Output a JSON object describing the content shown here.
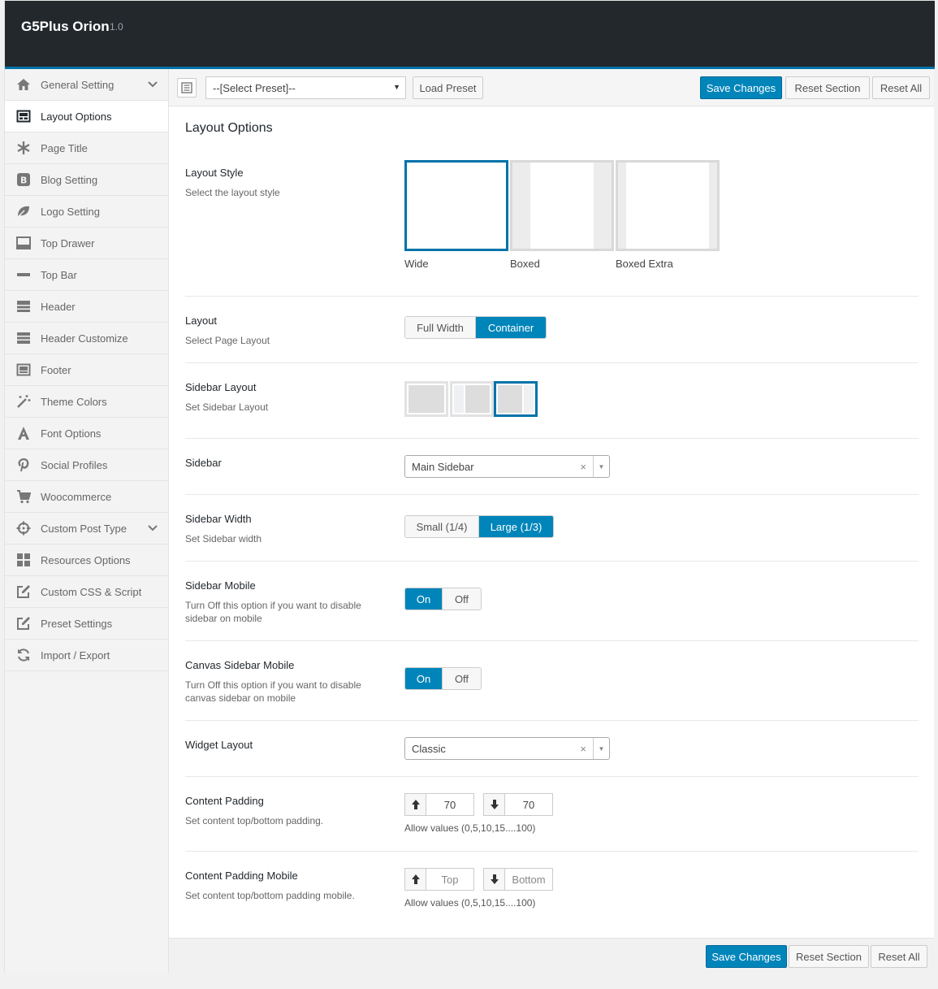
{
  "app": {
    "title": "G5Plus Orion",
    "version": "1.0"
  },
  "sidebar": {
    "items": [
      {
        "label": "General Setting",
        "icon": "home-icon"
      },
      {
        "label": "Layout Options",
        "icon": "layout-icon"
      },
      {
        "label": "Page Title",
        "icon": "asterisk-icon"
      },
      {
        "label": "Blog Setting",
        "icon": "blog-icon"
      },
      {
        "label": "Logo Setting",
        "icon": "leaf-icon"
      },
      {
        "label": "Top Drawer",
        "icon": "drawer-icon"
      },
      {
        "label": "Top Bar",
        "icon": "minus-icon"
      },
      {
        "label": "Header",
        "icon": "header-icon"
      },
      {
        "label": "Header Customize",
        "icon": "header-customize-icon"
      },
      {
        "label": "Footer",
        "icon": "footer-icon"
      },
      {
        "label": "Theme Colors",
        "icon": "magic-wand-icon"
      },
      {
        "label": "Font Options",
        "icon": "font-icon"
      },
      {
        "label": "Social Profiles",
        "icon": "pinterest-icon"
      },
      {
        "label": "Woocommerce",
        "icon": "cart-icon"
      },
      {
        "label": "Custom Post Type",
        "icon": "crosshairs-icon"
      },
      {
        "label": "Resources Options",
        "icon": "grid-icon"
      },
      {
        "label": "Custom CSS & Script",
        "icon": "edit-icon"
      },
      {
        "label": "Preset Settings",
        "icon": "edit-icon"
      },
      {
        "label": "Import / Export",
        "icon": "refresh-icon"
      }
    ]
  },
  "toolbar": {
    "preset_placeholder": "--[Select Preset]--",
    "load_preset": "Load Preset",
    "save_changes": "Save Changes",
    "reset_section": "Reset Section",
    "reset_all": "Reset All"
  },
  "section": {
    "title": "Layout Options",
    "layout_style": {
      "label": "Layout Style",
      "desc": "Select the layout style",
      "options": [
        "Wide",
        "Boxed",
        "Boxed Extra"
      ],
      "selected": "Wide"
    },
    "layout": {
      "label": "Layout",
      "desc": "Select Page Layout",
      "options": [
        "Full Width",
        "Container"
      ],
      "selected": "Container"
    },
    "sidebar_layout": {
      "label": "Sidebar Layout",
      "desc": "Set Sidebar Layout",
      "selected_index": 2
    },
    "sidebar": {
      "label": "Sidebar",
      "value": "Main Sidebar"
    },
    "sidebar_width": {
      "label": "Sidebar Width",
      "desc": "Set Sidebar width",
      "options": [
        "Small (1/4)",
        "Large (1/3)"
      ],
      "selected": "Large (1/3)"
    },
    "sidebar_mobile": {
      "label": "Sidebar Mobile",
      "desc": "Turn Off this option if you want to disable sidebar on mobile",
      "options": [
        "On",
        "Off"
      ],
      "selected": "On"
    },
    "canvas_sidebar_mobile": {
      "label": "Canvas Sidebar Mobile",
      "desc": "Turn Off this option if you want to disable canvas sidebar on mobile",
      "options": [
        "On",
        "Off"
      ],
      "selected": "On"
    },
    "widget_layout": {
      "label": "Widget Layout",
      "value": "Classic"
    },
    "content_padding": {
      "label": "Content Padding",
      "desc": "Set content top/bottom padding.",
      "top": "70",
      "bottom": "70",
      "hint": "Allow values (0,5,10,15....100)"
    },
    "content_padding_mobile": {
      "label": "Content Padding Mobile",
      "desc": "Set content top/bottom padding mobile.",
      "top_placeholder": "Top",
      "bottom_placeholder": "Bottom",
      "hint": "Allow values (0,5,10,15....100)"
    }
  },
  "colors": {
    "accent": "#0085ba",
    "dark_bar": "#23282d",
    "selected_border": "#0073aa"
  }
}
